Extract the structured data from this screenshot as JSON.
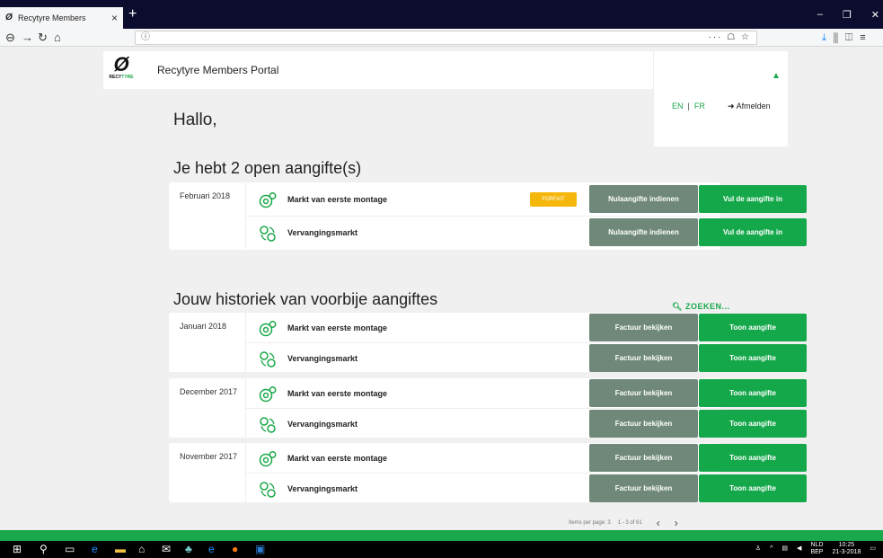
{
  "browser": {
    "tab_title": "Recytyre Members",
    "tab_close": "×",
    "new_tab": "+",
    "url": "",
    "url_info_icon": "ⓘ",
    "url_actions": "··· ☖ ☆",
    "right_icons": [
      "download-icon",
      "library-icon",
      "sidebar-icon",
      "menu-icon"
    ]
  },
  "header": {
    "logo_text": "RECYTYRE",
    "portal_title": "Recytyre Members Portal"
  },
  "user_panel": {
    "lang_en": "EN",
    "lang_sep": "|",
    "lang_fr": "FR",
    "logout_label": "Afmelden"
  },
  "greeting": "Hallo,",
  "open_section": {
    "title": "Je hebt 2 open aangifte(s)",
    "card": {
      "period": "Februari 2018",
      "rows": [
        {
          "name": "Markt van eerste montage",
          "badge": "FORFAIT",
          "btn_secondary": "Nulaangifte indienen",
          "btn_primary": "Vul de aangifte in"
        },
        {
          "name": "Vervangingsmarkt",
          "btn_secondary": "Nulaangifte indienen",
          "btn_primary": "Vul de aangifte in"
        }
      ]
    }
  },
  "history_section": {
    "title": "Jouw historiek van voorbije aangiftes",
    "search_label": "ZOEKEN...",
    "cards": [
      {
        "period": "Januari 2018",
        "rows": [
          {
            "name": "Markt van eerste montage",
            "btn_secondary": "Factuur bekijken",
            "btn_primary": "Toon aangifte"
          },
          {
            "name": "Vervangingsmarkt",
            "btn_secondary": "Factuur bekijken",
            "btn_primary": "Toon aangifte"
          }
        ]
      },
      {
        "period": "December 2017",
        "rows": [
          {
            "name": "Markt van eerste montage",
            "btn_secondary": "Factuur bekijken",
            "btn_primary": "Toon aangifte"
          },
          {
            "name": "Vervangingsmarkt",
            "btn_secondary": "Factuur bekijken",
            "btn_primary": "Toon aangifte"
          }
        ]
      },
      {
        "period": "November 2017",
        "rows": [
          {
            "name": "Markt van eerste montage",
            "btn_secondary": "Factuur bekijken",
            "btn_primary": "Toon aangifte"
          },
          {
            "name": "Vervangingsmarkt",
            "btn_secondary": "Factuur bekijken",
            "btn_primary": "Toon aangifte"
          }
        ]
      }
    ],
    "pager": {
      "items_per_page": "Items per page: 3",
      "range": "1 - 3 of 61",
      "prev": "‹",
      "next": "›"
    }
  },
  "taskbar": {
    "lang": "NLD",
    "lang_sub": "BEP",
    "time": "10:25",
    "date": "21-3-2018"
  },
  "colors": {
    "accent_green": "#15a84b",
    "secondary_grey": "#6f8879",
    "badge_yellow": "#f5b70c"
  }
}
